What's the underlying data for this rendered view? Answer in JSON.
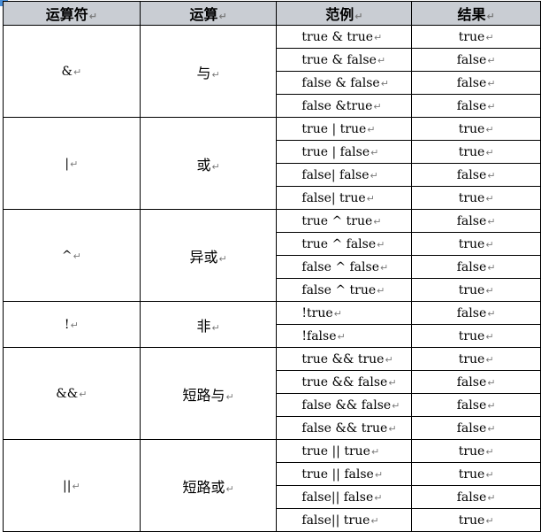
{
  "mark": "↵",
  "headers": [
    "运算符",
    "运算",
    "范例",
    "结果"
  ],
  "groups": [
    {
      "operator": "&",
      "name": "与",
      "rows": [
        {
          "example": "true & true",
          "result": "true"
        },
        {
          "example": "true & false",
          "result": "false"
        },
        {
          "example": "false & false",
          "result": "false"
        },
        {
          "example": "false &true",
          "result": "false"
        }
      ]
    },
    {
      "operator": "|",
      "name": "或",
      "rows": [
        {
          "example": "true | true",
          "result": "true"
        },
        {
          "example": "true | false",
          "result": "true"
        },
        {
          "example": "false| false",
          "result": "false"
        },
        {
          "example": "false| true",
          "result": "true"
        }
      ]
    },
    {
      "operator": "^",
      "name": "异或",
      "rows": [
        {
          "example": "true ^ true",
          "result": "false"
        },
        {
          "example": "true ^ false",
          "result": "true"
        },
        {
          "example": "false ^ false",
          "result": "false"
        },
        {
          "example": "false ^ true",
          "result": "true"
        }
      ]
    },
    {
      "operator": "!",
      "name": "非",
      "rows": [
        {
          "example": "!true",
          "result": "false"
        },
        {
          "example": "!false",
          "result": "true"
        }
      ]
    },
    {
      "operator": "&&",
      "name": "短路与",
      "rows": [
        {
          "example": "true && true",
          "result": "true"
        },
        {
          "example": "true && false",
          "result": "false"
        },
        {
          "example": "false && false",
          "result": "false"
        },
        {
          "example": "false && true",
          "result": "false"
        }
      ]
    },
    {
      "operator": "||",
      "name": "短路或",
      "rows": [
        {
          "example": "true || true",
          "result": "true"
        },
        {
          "example": "true || false",
          "result": "true"
        },
        {
          "example": "false|| false",
          "result": "false"
        },
        {
          "example": "false|| true",
          "result": "true"
        }
      ]
    }
  ]
}
